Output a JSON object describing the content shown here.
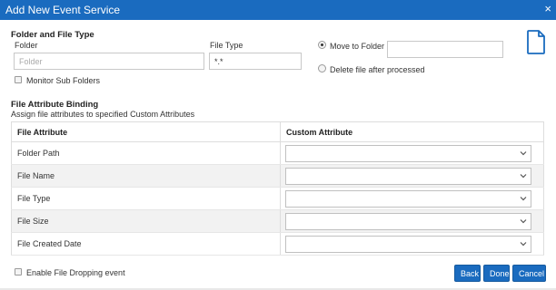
{
  "dialog": {
    "title": "Add New Event Service"
  },
  "folder_section": {
    "heading": "Folder and File Type",
    "folder_label": "Folder",
    "folder_placeholder": "Folder",
    "filetype_label": "File Type",
    "filetype_value": "*.*",
    "monitor_subfolders_label": "Monitor Sub Folders",
    "monitor_subfolders_checked": false,
    "move_to_folder_label": "Move to Folder",
    "move_to_folder_selected": true,
    "move_to_folder_value": "",
    "delete_after_label": "Delete file after processed",
    "delete_after_selected": false
  },
  "binding_section": {
    "heading": "File Attribute Binding",
    "subheading": "Assign file attributes to specified Custom Attributes",
    "columns": [
      "File Attribute",
      "Custom Attribute"
    ],
    "rows": [
      {
        "attribute": "Folder Path",
        "custom": ""
      },
      {
        "attribute": "File Name",
        "custom": ""
      },
      {
        "attribute": "File Type",
        "custom": ""
      },
      {
        "attribute": "File Size",
        "custom": ""
      },
      {
        "attribute": "File Created Date",
        "custom": ""
      }
    ]
  },
  "footer": {
    "enable_dropping_label": "Enable File Dropping event",
    "enable_dropping_checked": false,
    "buttons": {
      "back": "Back",
      "done": "Done",
      "cancel": "Cancel"
    }
  },
  "icons": {
    "close": "close-icon",
    "document": "document-icon",
    "chevron": "chevron-down-icon"
  },
  "colors": {
    "accent": "#1a6bbf",
    "row_alt": "#f2f2f2",
    "border": "#dddddd"
  }
}
